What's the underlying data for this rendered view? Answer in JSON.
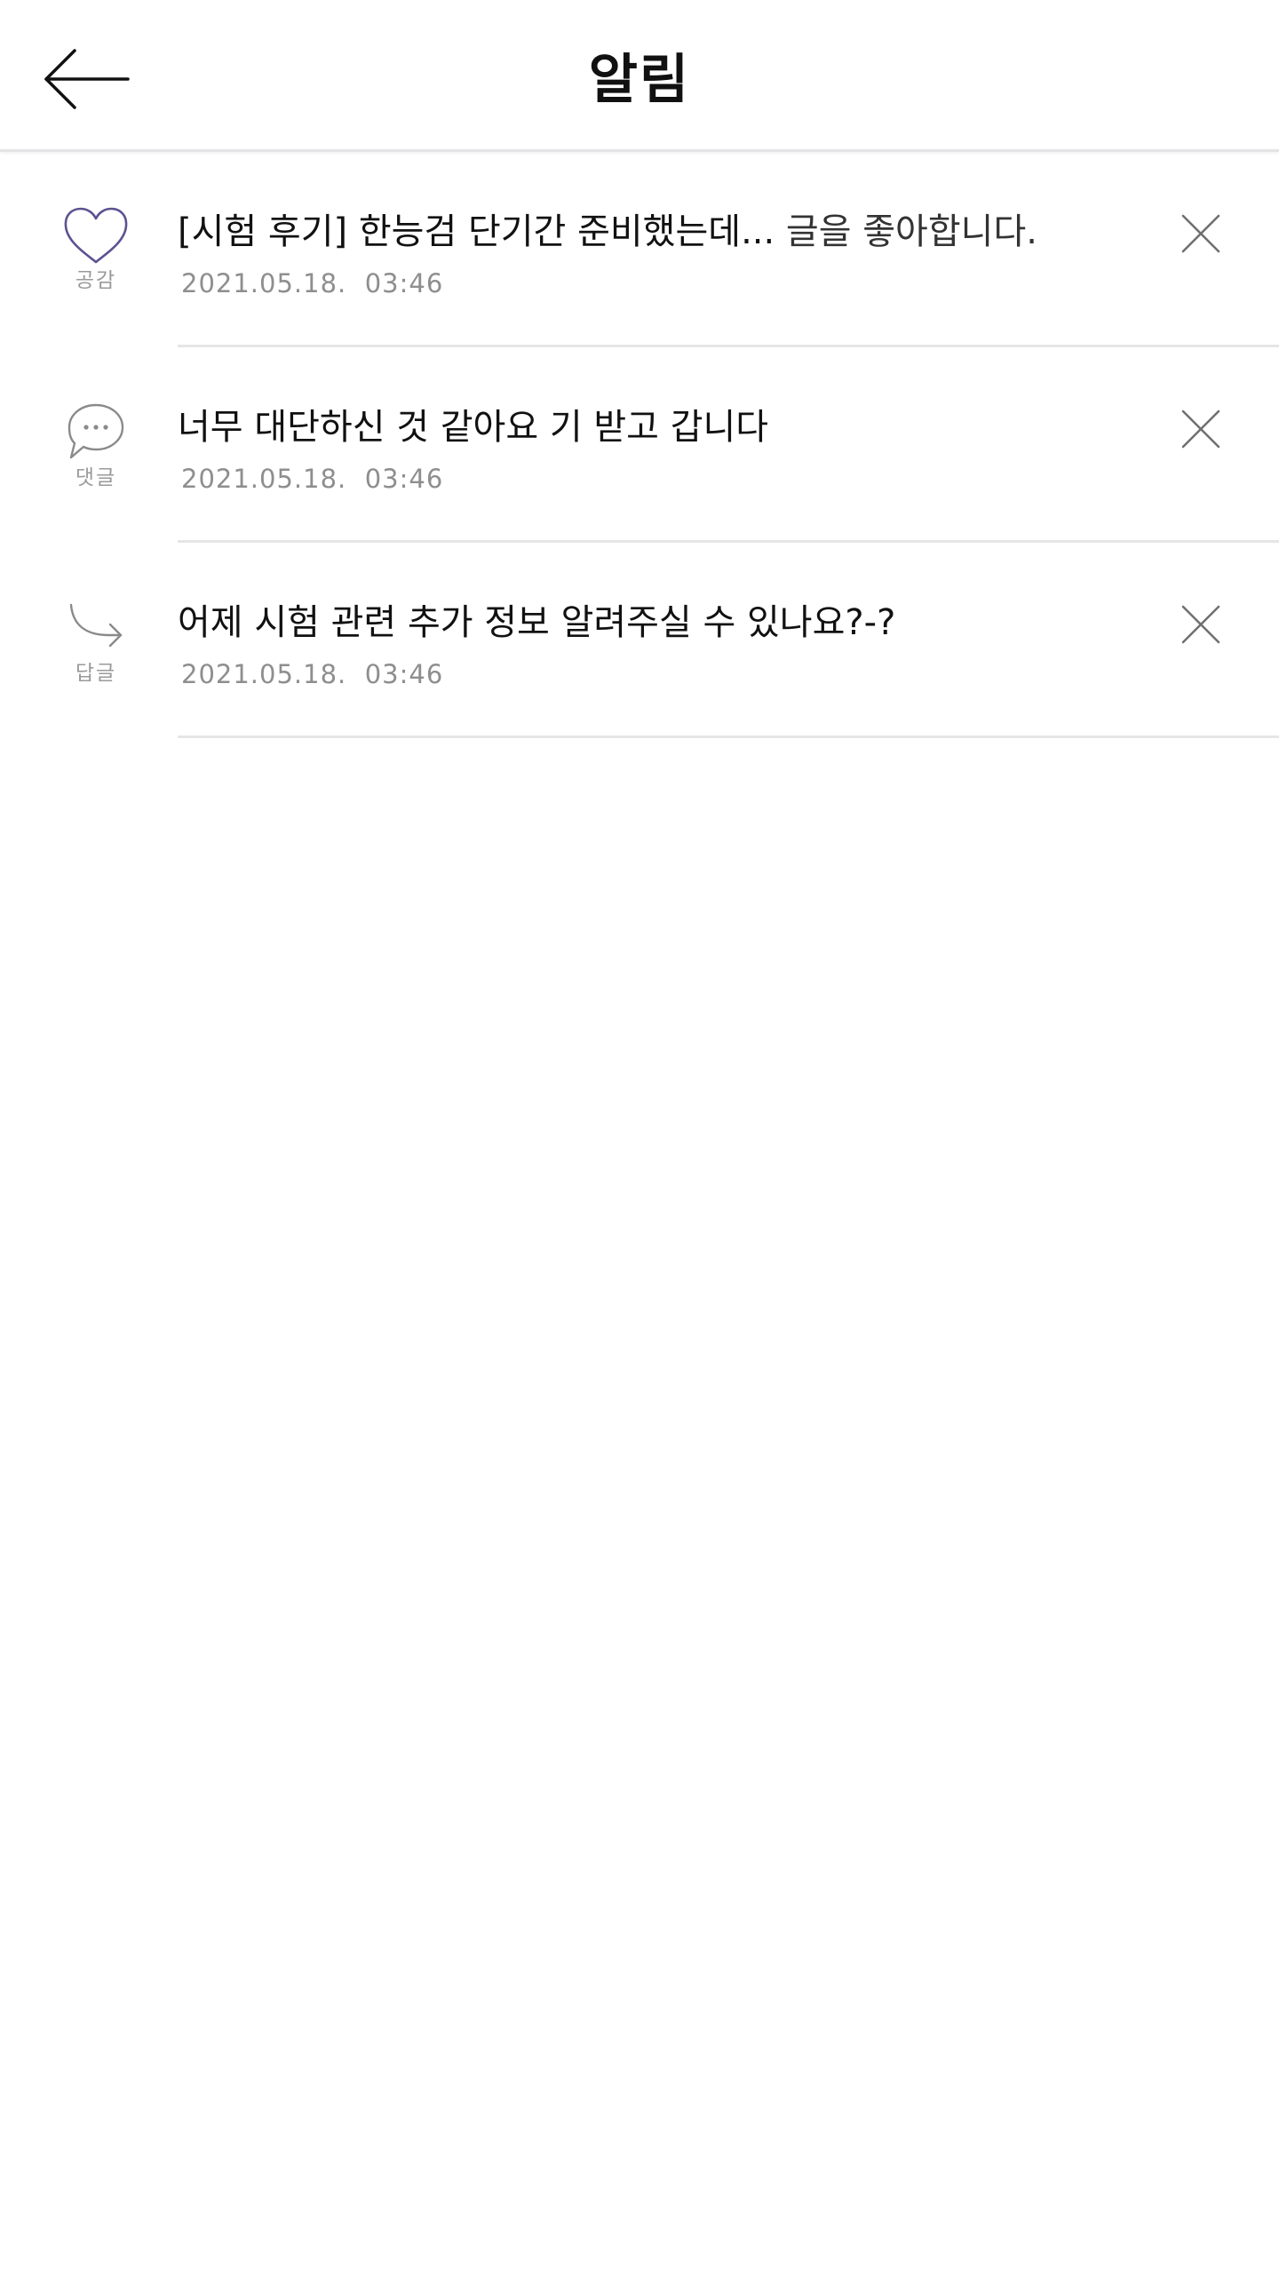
{
  "header": {
    "title": "알림",
    "back_icon": "arrow-left-icon"
  },
  "colors": {
    "heart_accent": "#5b5391",
    "icon_gray": "#8a8a8a",
    "date_gray": "#8e8e8e",
    "divider": "#e6e6e6"
  },
  "notifications": [
    {
      "type_icon": "heart-icon",
      "type_label": "공감",
      "title": "[시험 후기] 한능검 단기간 준비했는데...",
      "title_suffix": " 글을 좋아합니다.",
      "date": "2021.05.18.  03:46",
      "close_icon": "close-icon"
    },
    {
      "type_icon": "speech-bubble-icon",
      "type_label": "댓글",
      "title": "너무 대단하신 것 같아요 기 받고 갑니다",
      "title_suffix": "",
      "date": "2021.05.18.  03:46",
      "close_icon": "close-icon"
    },
    {
      "type_icon": "reply-arrow-icon",
      "type_label": "답글",
      "title": "어제 시험 관련 추가 정보 알려주실 수 있나요?-?",
      "title_suffix": "",
      "date": "2021.05.18.  03:46",
      "close_icon": "close-icon"
    }
  ]
}
